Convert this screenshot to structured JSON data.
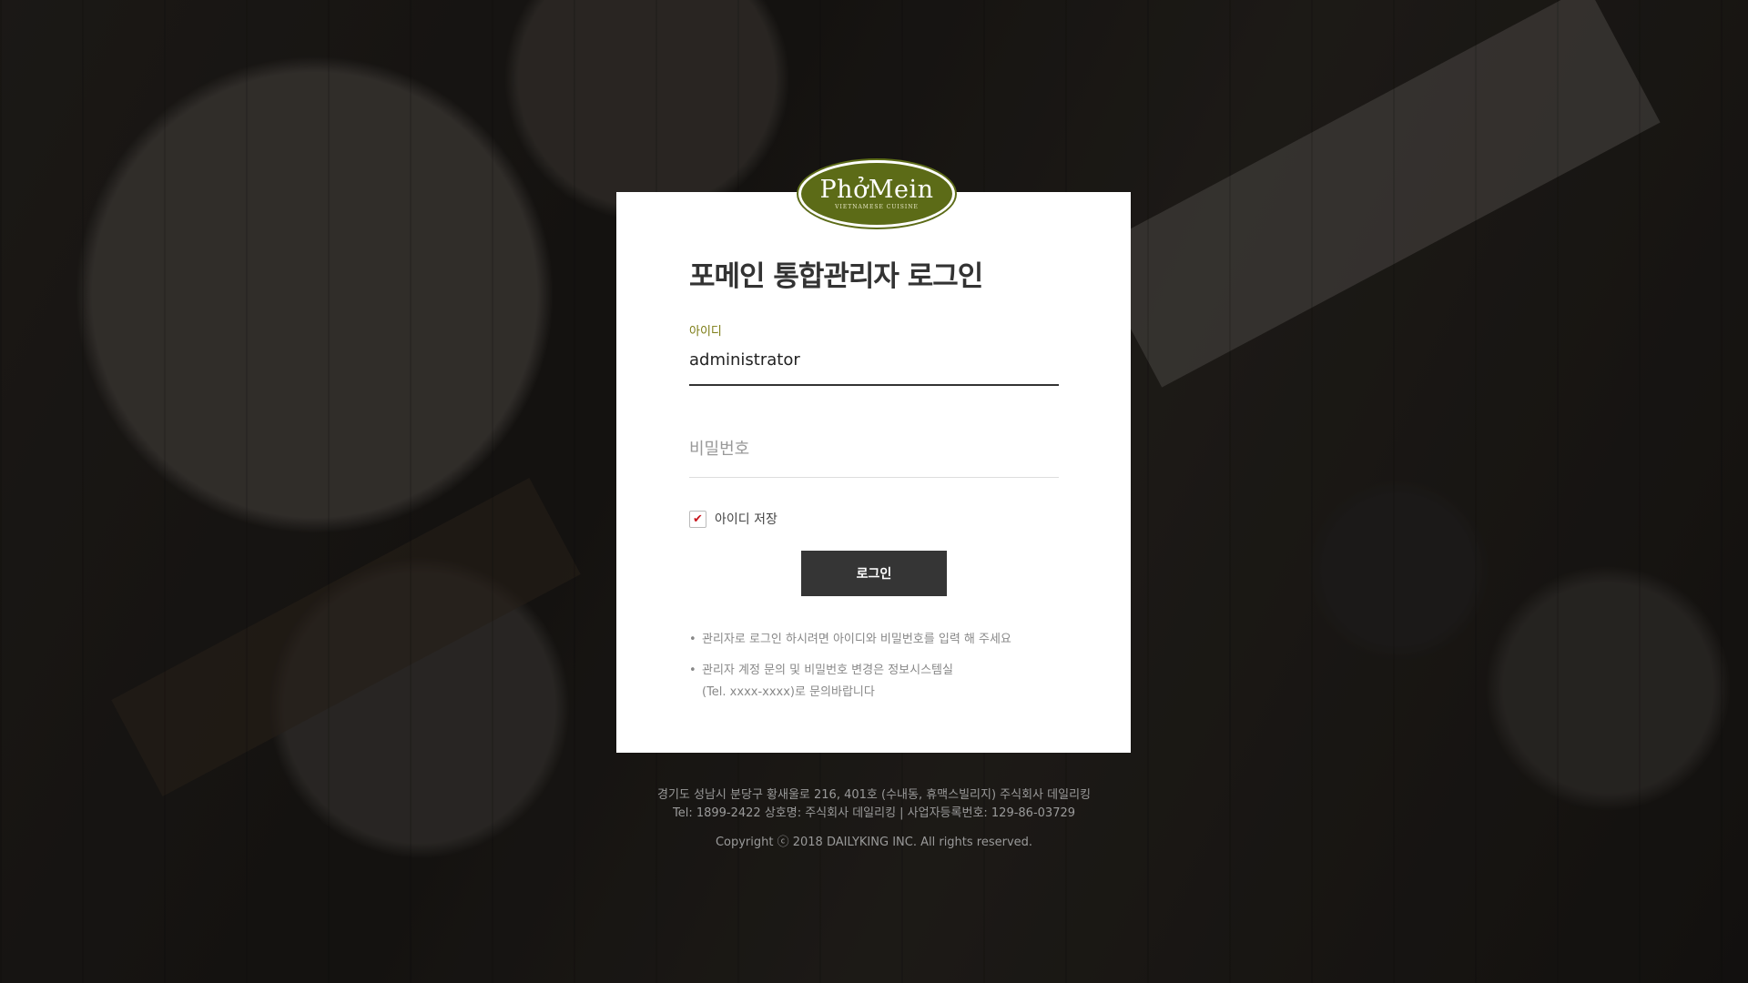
{
  "logo": {
    "name": "PhởMein",
    "tagline": "VIETNAMESE CUISINE"
  },
  "login": {
    "title": "포메인 통합관리자 로그인",
    "id_label": "아이디",
    "id_value": "administrator",
    "password_placeholder": "비밀번호",
    "remember_label": "아이디 저장",
    "remember_checked": true,
    "checkbox_mark": "✔",
    "button_label": "로그인"
  },
  "notes": [
    {
      "lines": [
        "관리자로 로그인 하시려면 아이디와 비밀번호를 입력 해 주세요"
      ]
    },
    {
      "lines": [
        "관리자 계정 문의 및 비밀번호 변경은 정보시스템실",
        "(Tel. xxxx-xxxx)로 문의바랍니다"
      ]
    }
  ],
  "footer": {
    "address": "경기도 성남시 분당구 황새울로 216, 401호 (수내동, 휴맥스빌리지) 주식회사 데일리킹",
    "contact": "Tel: 1899-2422 상호명: 주식회사 데일리킹 | 사업자등록번호: 129-86-03729",
    "copyright": "Copyright ⓒ 2018 DAILYKING INC. All rights reserved."
  },
  "colors": {
    "accent": "#5c6b17",
    "button": "#353535",
    "check": "#c8161d"
  }
}
